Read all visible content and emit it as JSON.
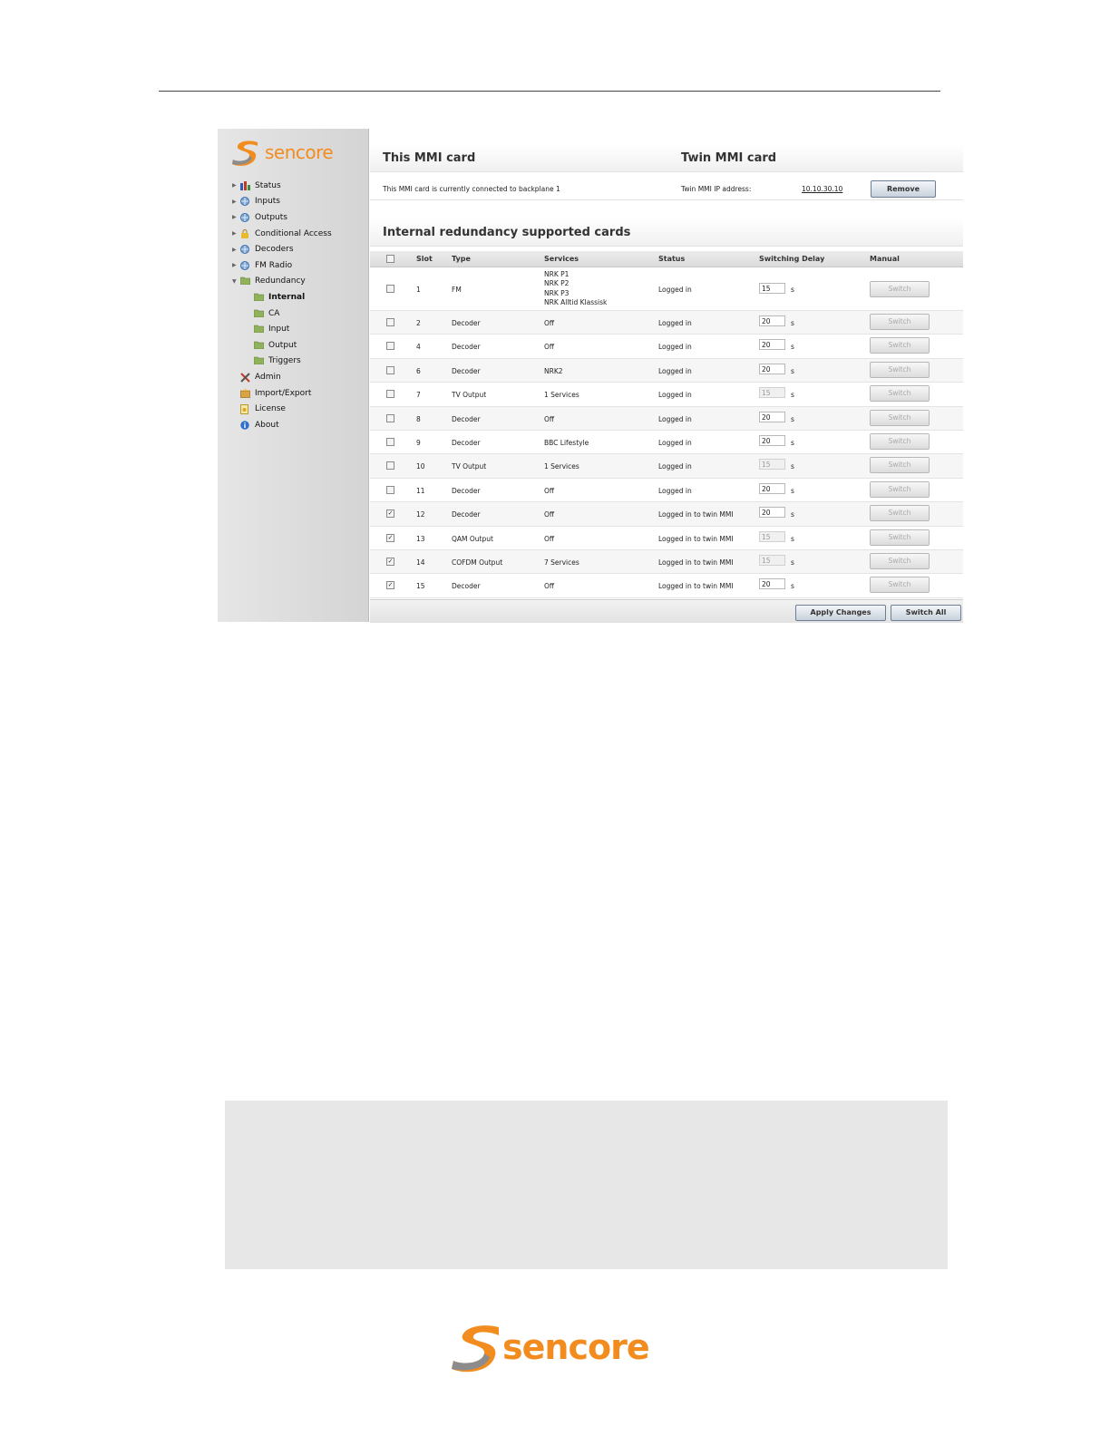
{
  "brand": {
    "name": "sencore",
    "accent": "#f28c1e"
  },
  "sidebar": {
    "items": [
      {
        "label": "Status",
        "icon": "bar-chart-icon",
        "level": 0
      },
      {
        "label": "Inputs",
        "icon": "globe-icon",
        "level": 0
      },
      {
        "label": "Outputs",
        "icon": "globe-icon",
        "level": 0
      },
      {
        "label": "Conditional Access",
        "icon": "lock-icon",
        "level": 0
      },
      {
        "label": "Decoders",
        "icon": "globe-icon",
        "level": 0
      },
      {
        "label": "FM Radio",
        "icon": "globe-icon",
        "level": 0
      },
      {
        "label": "Redundancy",
        "icon": "folder-icon",
        "level": 0
      },
      {
        "label": "Internal",
        "icon": "folder-icon",
        "level": 1
      },
      {
        "label": "CA",
        "icon": "folder-icon",
        "level": 1
      },
      {
        "label": "Input",
        "icon": "folder-icon",
        "level": 1
      },
      {
        "label": "Output",
        "icon": "folder-icon",
        "level": 1
      },
      {
        "label": "Triggers",
        "icon": "folder-icon",
        "level": 1
      },
      {
        "label": "Admin",
        "icon": "tools-icon",
        "level": 0
      },
      {
        "label": "Import/Export",
        "icon": "box-icon",
        "level": 0
      },
      {
        "label": "License",
        "icon": "certificate-icon",
        "level": 0
      },
      {
        "label": "About",
        "icon": "info-icon",
        "level": 0
      }
    ]
  },
  "mmi": {
    "this_title": "This MMI card",
    "twin_title": "Twin MMI card",
    "this_status": "This MMI card is currently connected to backplane 1",
    "twin_ip_label": "Twin MMI IP address:",
    "twin_ip": "10.10.30.10",
    "remove_label": "Remove"
  },
  "redundancy": {
    "title": "Internal redundancy supported cards",
    "columns": {
      "slot": "Slot",
      "type": "Type",
      "services": "Services",
      "status": "Status",
      "delay": "Switching Delay",
      "manual": "Manual"
    },
    "unit": "s",
    "switch_label": "Switch",
    "rows": [
      {
        "checked": false,
        "slot": "1",
        "type": "FM",
        "services": [
          "NRK P1",
          "NRK P2",
          "NRK P3",
          "NRK Alltid Klassisk"
        ],
        "status": "Logged in",
        "delay": "15",
        "delay_enabled": true
      },
      {
        "checked": false,
        "slot": "2",
        "type": "Decoder",
        "services": [
          "Off"
        ],
        "status": "Logged in",
        "delay": "20",
        "delay_enabled": true
      },
      {
        "checked": false,
        "slot": "4",
        "type": "Decoder",
        "services": [
          "Off"
        ],
        "status": "Logged in",
        "delay": "20",
        "delay_enabled": true
      },
      {
        "checked": false,
        "slot": "6",
        "type": "Decoder",
        "services": [
          "NRK2"
        ],
        "status": "Logged in",
        "delay": "20",
        "delay_enabled": true
      },
      {
        "checked": false,
        "slot": "7",
        "type": "TV Output",
        "services": [
          "1 Services"
        ],
        "status": "Logged in",
        "delay": "15",
        "delay_enabled": false
      },
      {
        "checked": false,
        "slot": "8",
        "type": "Decoder",
        "services": [
          "Off"
        ],
        "status": "Logged in",
        "delay": "20",
        "delay_enabled": true
      },
      {
        "checked": false,
        "slot": "9",
        "type": "Decoder",
        "services": [
          "BBC Lifestyle"
        ],
        "status": "Logged in",
        "delay": "20",
        "delay_enabled": true
      },
      {
        "checked": false,
        "slot": "10",
        "type": "TV Output",
        "services": [
          "1 Services"
        ],
        "status": "Logged in",
        "delay": "15",
        "delay_enabled": false
      },
      {
        "checked": false,
        "slot": "11",
        "type": "Decoder",
        "services": [
          "Off"
        ],
        "status": "Logged in",
        "delay": "20",
        "delay_enabled": true
      },
      {
        "checked": true,
        "slot": "12",
        "type": "Decoder",
        "services": [
          "Off"
        ],
        "status": "Logged in to twin MMI",
        "delay": "20",
        "delay_enabled": true
      },
      {
        "checked": true,
        "slot": "13",
        "type": "QAM Output",
        "services": [
          "Off"
        ],
        "status": "Logged in to twin MMI",
        "delay": "15",
        "delay_enabled": false
      },
      {
        "checked": true,
        "slot": "14",
        "type": "COFDM Output",
        "services": [
          "7 Services"
        ],
        "status": "Logged in to twin MMI",
        "delay": "15",
        "delay_enabled": false
      },
      {
        "checked": true,
        "slot": "15",
        "type": "Decoder",
        "services": [
          "Off"
        ],
        "status": "Logged in to twin MMI",
        "delay": "20",
        "delay_enabled": true
      }
    ],
    "apply_label": "Apply Changes",
    "switch_all_label": "Switch All"
  },
  "footer": {
    "logo_text": "sencore"
  }
}
